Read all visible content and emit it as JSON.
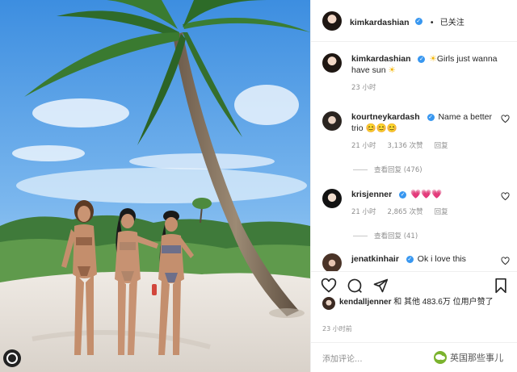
{
  "post": {
    "author": "kimkardashian",
    "follow_status": "已关注",
    "caption_author": "kimkardashian",
    "caption_text": "Girls just wanna have sun",
    "caption_time": "23 小时",
    "accent": "#3897f0"
  },
  "comments": [
    {
      "user": "kourtneykardash",
      "text": "Name a better trio 😊😊😊",
      "time": "21 小时",
      "likes": "3,136 次赞",
      "reply": "回复",
      "view_replies": "查看回复 (476)"
    },
    {
      "user": "krisjenner",
      "text": "💗💗💗",
      "time": "21 小时",
      "likes": "2,865 次赞",
      "reply": "回复",
      "view_replies": "查看回复 (41)"
    },
    {
      "user": "jenatkinhair",
      "text": "Ok i love this"
    }
  ],
  "likes_line": {
    "user": "kendalljenner",
    "text": "和 其他 483.6万 位用户赞了"
  },
  "post_time": "23 小时前",
  "add_comment_placeholder": "添加评论...",
  "watermark": "英国那些事儿",
  "icons": [
    "heart-icon",
    "comment-icon",
    "share-icon",
    "bookmark-icon"
  ]
}
